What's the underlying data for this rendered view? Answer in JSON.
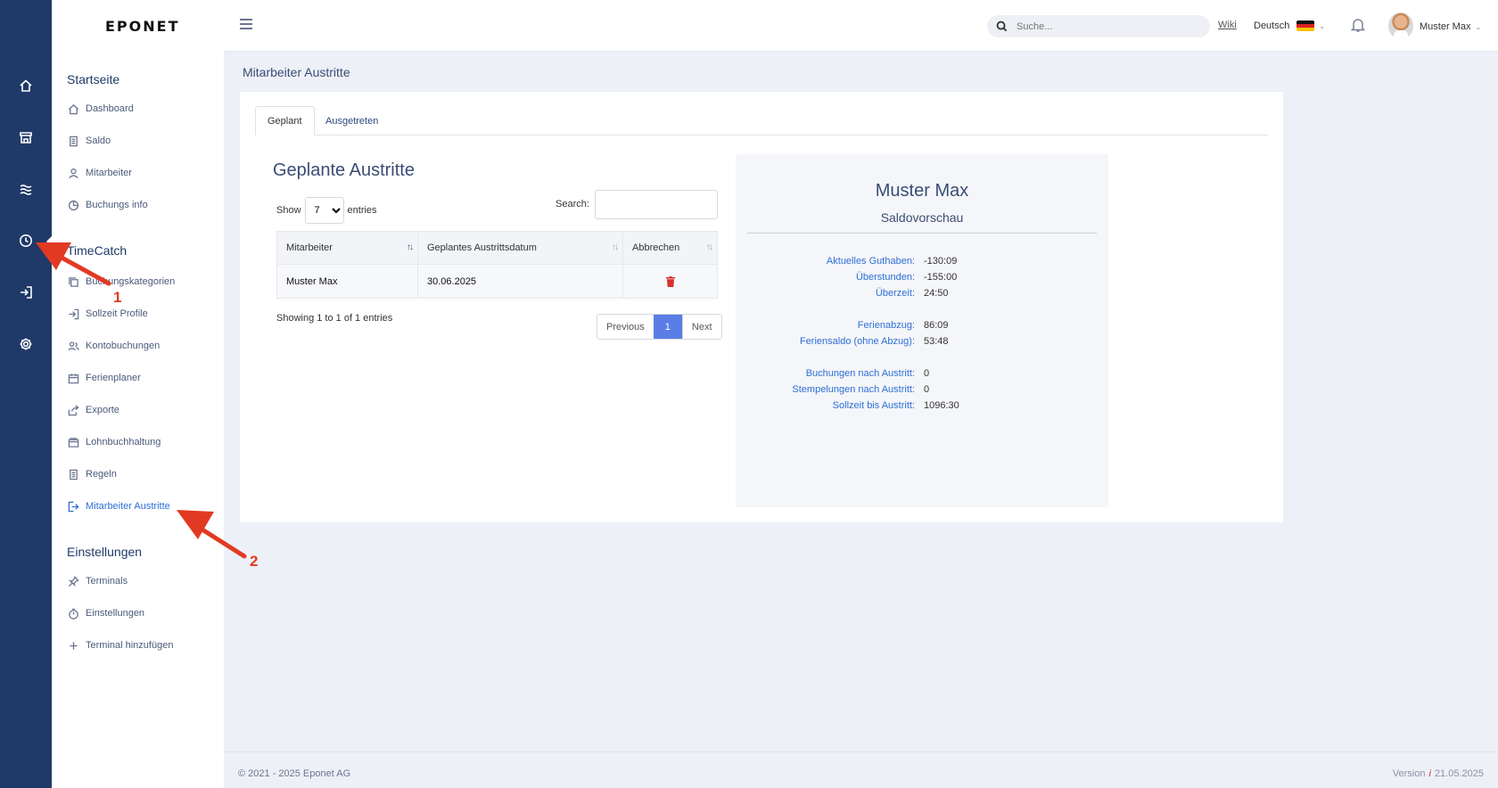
{
  "brand": {
    "logo_text": "EPONET"
  },
  "rail": {
    "icons": [
      "home-icon",
      "store-icon",
      "waves-icon",
      "clock-icon",
      "login-icon",
      "gear-icon"
    ]
  },
  "sidebar": {
    "sections": [
      {
        "title": "Startseite",
        "items": [
          "Dashboard",
          "Saldo",
          "Mitarbeiter",
          "Buchungs info"
        ]
      },
      {
        "title": "TimeCatch",
        "items": [
          "Buchungskategorien",
          "Sollzeit Profile",
          "Kontobuchungen",
          "Ferienplaner",
          "Exporte",
          "Lohnbuchhaltung",
          "Regeln",
          "Mitarbeiter Austritte"
        ]
      },
      {
        "title": "Einstellungen",
        "items": [
          "Terminals",
          "Einstellungen",
          "Terminal hinzufügen"
        ]
      }
    ],
    "active_item": "Mitarbeiter Austritte"
  },
  "topbar": {
    "search_placeholder": "Suche...",
    "wiki": "Wiki",
    "language": "Deutsch",
    "user": "Muster Max"
  },
  "page": {
    "title": "Mitarbeiter Austritte"
  },
  "tabs": [
    "Geplant",
    "Ausgetreten"
  ],
  "table_section": {
    "heading": "Geplante Austritte",
    "show_label": "Show",
    "entries_value": "7",
    "entries_label": "entries",
    "search_label": "Search:",
    "columns": [
      "Mitarbeiter",
      "Geplantes Austrittsdatum",
      "Abbrechen"
    ],
    "rows": [
      {
        "mitarbeiter": "Muster Max",
        "datum": "30.06.2025"
      }
    ],
    "info": "Showing 1 to 1 of 1 entries",
    "pagination": {
      "previous": "Previous",
      "current": "1",
      "next": "Next"
    }
  },
  "preview": {
    "name": "Muster Max",
    "subtitle": "Saldovorschau",
    "rows": [
      {
        "label": "Aktuelles Guthaben:",
        "value": "-130:09"
      },
      {
        "label": "Überstunden:",
        "value": "-155:00"
      },
      {
        "label": "Überzeit:",
        "value": "24:50"
      },
      {
        "label": "Ferienabzug:",
        "value": "86:09"
      },
      {
        "label": "Feriensaldo (ohne Abzug):",
        "value": "53:48"
      },
      {
        "label": "Buchungen nach Austritt:",
        "value": "0"
      },
      {
        "label": "Stempelungen nach Austritt:",
        "value": "0"
      },
      {
        "label": "Sollzeit bis Austritt:",
        "value": "1096:30"
      }
    ]
  },
  "footer": {
    "copyright": "© 2021 - 2025 Eponet AG",
    "version_label": "Version",
    "version_icon": "i",
    "version_date": "21.05.2025"
  },
  "annotations": {
    "arrow1": "1",
    "arrow2": "2",
    "color": "#e23a22"
  }
}
